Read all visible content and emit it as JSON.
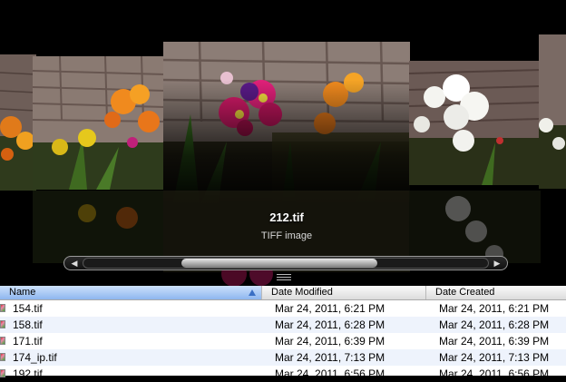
{
  "coverflow": {
    "selected_title": "212.tif",
    "selected_kind": "TIFF image",
    "scroll_left_glyph": "◀",
    "scroll_right_glyph": "▶"
  },
  "list": {
    "columns": {
      "name": "Name",
      "modified": "Date Modified",
      "created": "Date Created"
    },
    "sort_column": "Name",
    "rows": [
      {
        "name": "154.tif",
        "modified": "Mar 24, 2011, 6:21 PM",
        "created": "Mar 24, 2011, 6:21 PM"
      },
      {
        "name": "158.tif",
        "modified": "Mar 24, 2011, 6:28 PM",
        "created": "Mar 24, 2011, 6:28 PM"
      },
      {
        "name": "171.tif",
        "modified": "Mar 24, 2011, 6:39 PM",
        "created": "Mar 24, 2011, 6:39 PM"
      },
      {
        "name": "174_ip.tif",
        "modified": "Mar 24, 2011, 7:13 PM",
        "created": "Mar 24, 2011, 7:13 PM"
      },
      {
        "name": "192.tif",
        "modified": "Mar 24, 2011, 6:56 PM",
        "created": "Mar 24, 2011, 6:56 PM"
      }
    ]
  },
  "colors": {
    "header_selected": "#8eb6ef",
    "row_alt": "#eef3fc",
    "coverflow_bg": "#000000"
  }
}
